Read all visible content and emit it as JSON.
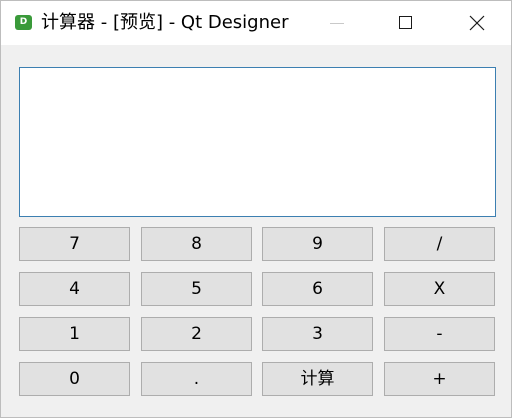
{
  "window": {
    "icon_label": "D",
    "title": "计算器 - [预览] - Qt Designer"
  },
  "display": {
    "value": ""
  },
  "keys": [
    [
      "7",
      "8",
      "9",
      "/"
    ],
    [
      "4",
      "5",
      "6",
      "X"
    ],
    [
      "1",
      "2",
      "3",
      "-"
    ],
    [
      "0",
      ".",
      "计算",
      "+"
    ]
  ]
}
